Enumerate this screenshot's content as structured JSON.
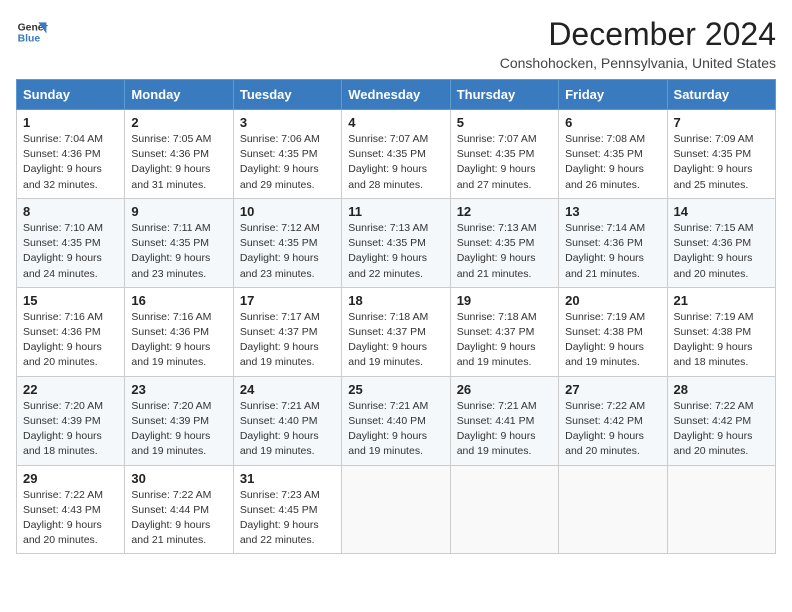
{
  "header": {
    "logo_line1": "General",
    "logo_line2": "Blue",
    "month_year": "December 2024",
    "location": "Conshohocken, Pennsylvania, United States"
  },
  "calendar": {
    "headers": [
      "Sunday",
      "Monday",
      "Tuesday",
      "Wednesday",
      "Thursday",
      "Friday",
      "Saturday"
    ],
    "weeks": [
      [
        {
          "day": "1",
          "sunrise": "7:04 AM",
          "sunset": "4:36 PM",
          "daylight": "9 hours and 32 minutes."
        },
        {
          "day": "2",
          "sunrise": "7:05 AM",
          "sunset": "4:36 PM",
          "daylight": "9 hours and 31 minutes."
        },
        {
          "day": "3",
          "sunrise": "7:06 AM",
          "sunset": "4:35 PM",
          "daylight": "9 hours and 29 minutes."
        },
        {
          "day": "4",
          "sunrise": "7:07 AM",
          "sunset": "4:35 PM",
          "daylight": "9 hours and 28 minutes."
        },
        {
          "day": "5",
          "sunrise": "7:07 AM",
          "sunset": "4:35 PM",
          "daylight": "9 hours and 27 minutes."
        },
        {
          "day": "6",
          "sunrise": "7:08 AM",
          "sunset": "4:35 PM",
          "daylight": "9 hours and 26 minutes."
        },
        {
          "day": "7",
          "sunrise": "7:09 AM",
          "sunset": "4:35 PM",
          "daylight": "9 hours and 25 minutes."
        }
      ],
      [
        {
          "day": "8",
          "sunrise": "7:10 AM",
          "sunset": "4:35 PM",
          "daylight": "9 hours and 24 minutes."
        },
        {
          "day": "9",
          "sunrise": "7:11 AM",
          "sunset": "4:35 PM",
          "daylight": "9 hours and 23 minutes."
        },
        {
          "day": "10",
          "sunrise": "7:12 AM",
          "sunset": "4:35 PM",
          "daylight": "9 hours and 23 minutes."
        },
        {
          "day": "11",
          "sunrise": "7:13 AM",
          "sunset": "4:35 PM",
          "daylight": "9 hours and 22 minutes."
        },
        {
          "day": "12",
          "sunrise": "7:13 AM",
          "sunset": "4:35 PM",
          "daylight": "9 hours and 21 minutes."
        },
        {
          "day": "13",
          "sunrise": "7:14 AM",
          "sunset": "4:36 PM",
          "daylight": "9 hours and 21 minutes."
        },
        {
          "day": "14",
          "sunrise": "7:15 AM",
          "sunset": "4:36 PM",
          "daylight": "9 hours and 20 minutes."
        }
      ],
      [
        {
          "day": "15",
          "sunrise": "7:16 AM",
          "sunset": "4:36 PM",
          "daylight": "9 hours and 20 minutes."
        },
        {
          "day": "16",
          "sunrise": "7:16 AM",
          "sunset": "4:36 PM",
          "daylight": "9 hours and 19 minutes."
        },
        {
          "day": "17",
          "sunrise": "7:17 AM",
          "sunset": "4:37 PM",
          "daylight": "9 hours and 19 minutes."
        },
        {
          "day": "18",
          "sunrise": "7:18 AM",
          "sunset": "4:37 PM",
          "daylight": "9 hours and 19 minutes."
        },
        {
          "day": "19",
          "sunrise": "7:18 AM",
          "sunset": "4:37 PM",
          "daylight": "9 hours and 19 minutes."
        },
        {
          "day": "20",
          "sunrise": "7:19 AM",
          "sunset": "4:38 PM",
          "daylight": "9 hours and 19 minutes."
        },
        {
          "day": "21",
          "sunrise": "7:19 AM",
          "sunset": "4:38 PM",
          "daylight": "9 hours and 18 minutes."
        }
      ],
      [
        {
          "day": "22",
          "sunrise": "7:20 AM",
          "sunset": "4:39 PM",
          "daylight": "9 hours and 18 minutes."
        },
        {
          "day": "23",
          "sunrise": "7:20 AM",
          "sunset": "4:39 PM",
          "daylight": "9 hours and 19 minutes."
        },
        {
          "day": "24",
          "sunrise": "7:21 AM",
          "sunset": "4:40 PM",
          "daylight": "9 hours and 19 minutes."
        },
        {
          "day": "25",
          "sunrise": "7:21 AM",
          "sunset": "4:40 PM",
          "daylight": "9 hours and 19 minutes."
        },
        {
          "day": "26",
          "sunrise": "7:21 AM",
          "sunset": "4:41 PM",
          "daylight": "9 hours and 19 minutes."
        },
        {
          "day": "27",
          "sunrise": "7:22 AM",
          "sunset": "4:42 PM",
          "daylight": "9 hours and 20 minutes."
        },
        {
          "day": "28",
          "sunrise": "7:22 AM",
          "sunset": "4:42 PM",
          "daylight": "9 hours and 20 minutes."
        }
      ],
      [
        {
          "day": "29",
          "sunrise": "7:22 AM",
          "sunset": "4:43 PM",
          "daylight": "9 hours and 20 minutes."
        },
        {
          "day": "30",
          "sunrise": "7:22 AM",
          "sunset": "4:44 PM",
          "daylight": "9 hours and 21 minutes."
        },
        {
          "day": "31",
          "sunrise": "7:23 AM",
          "sunset": "4:45 PM",
          "daylight": "9 hours and 22 minutes."
        },
        null,
        null,
        null,
        null
      ]
    ]
  }
}
